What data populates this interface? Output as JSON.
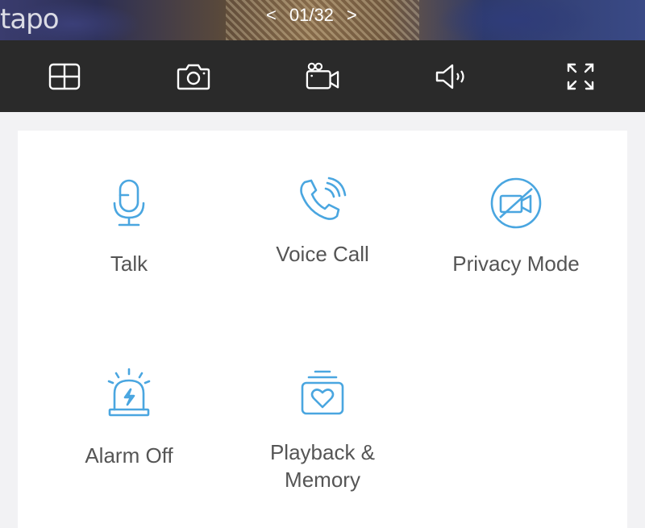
{
  "feed": {
    "logo": "tapo",
    "pager": {
      "prev": "<",
      "position": "01/32",
      "next": ">"
    }
  },
  "toolbar": {
    "items": [
      {
        "name": "multi-view",
        "icon": "grid-icon"
      },
      {
        "name": "snapshot",
        "icon": "camera-icon"
      },
      {
        "name": "record",
        "icon": "video-camera-icon"
      },
      {
        "name": "sound",
        "icon": "speaker-icon"
      },
      {
        "name": "fullscreen",
        "icon": "fullscreen-icon"
      }
    ]
  },
  "actions": {
    "talk": {
      "label": "Talk",
      "icon": "microphone-icon"
    },
    "voice_call": {
      "label": "Voice Call",
      "icon": "phone-call-icon"
    },
    "privacy_mode": {
      "label": "Privacy Mode",
      "icon": "privacy-camera-off-icon"
    },
    "alarm": {
      "label": "Alarm Off",
      "icon": "alarm-siren-icon"
    },
    "playback": {
      "label_line1": "Playback &",
      "label_line2": "Memory",
      "icon": "playback-memory-icon"
    }
  },
  "colors": {
    "accent": "#4aa6e0",
    "toolbar_bg": "#2a2a2a",
    "label_text": "#555555"
  }
}
